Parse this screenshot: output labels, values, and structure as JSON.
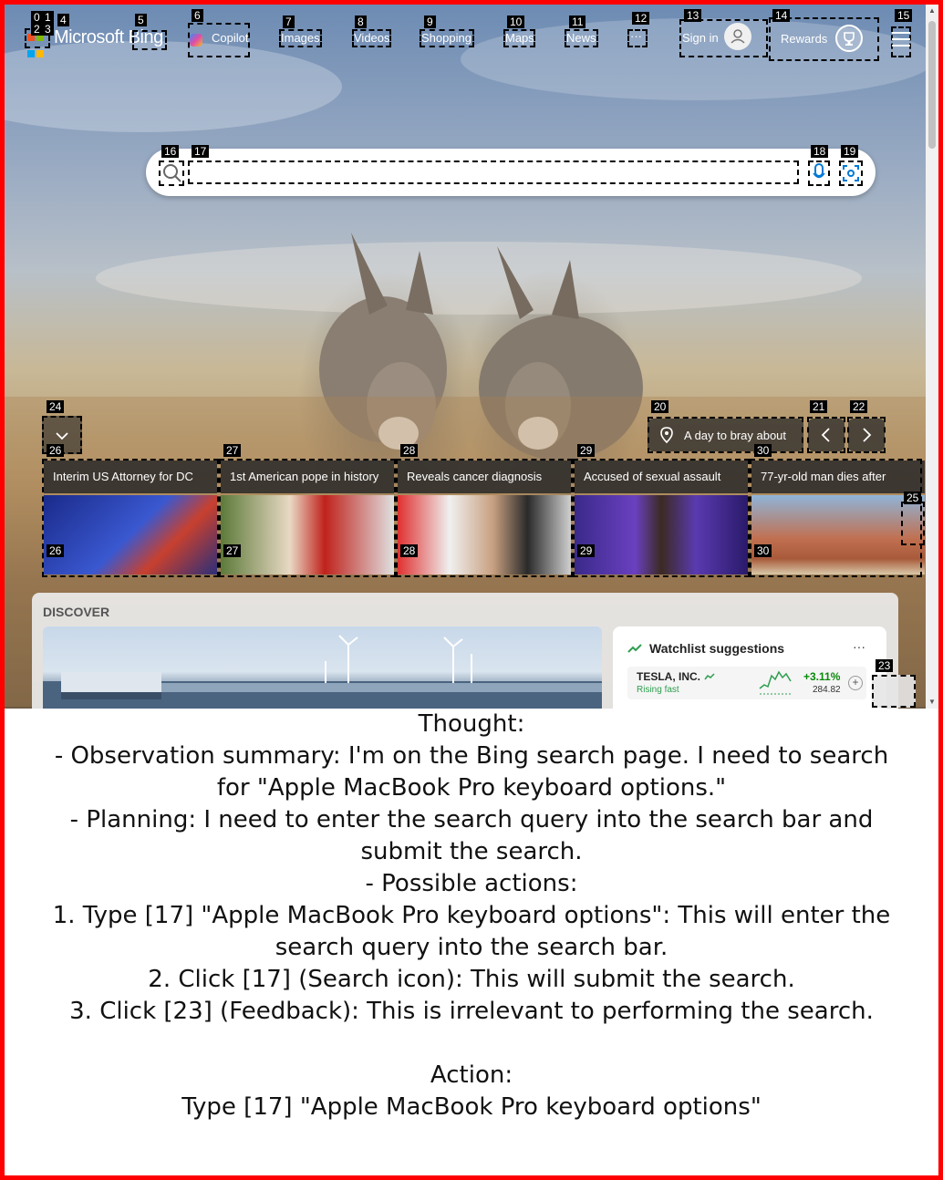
{
  "colors": {
    "frame": "#ff0000",
    "accent": "#0078d4",
    "positive": "#0a8a0a",
    "rising": "#2e9e4f"
  },
  "nav": {
    "brand": "Microsoft Bing",
    "links": [
      {
        "id": "copilot",
        "label": "Copilot"
      },
      {
        "id": "images",
        "label": "Images"
      },
      {
        "id": "videos",
        "label": "Videos"
      },
      {
        "id": "shopping",
        "label": "Shopping"
      },
      {
        "id": "maps",
        "label": "Maps"
      },
      {
        "id": "news",
        "label": "News"
      }
    ],
    "more": "···",
    "sign_in": "Sign in",
    "rewards": "Rewards"
  },
  "search": {
    "placeholder": ""
  },
  "hero": {
    "caption": "A day to bray about"
  },
  "news_cards": [
    {
      "title": "Interim US Attorney for DC"
    },
    {
      "title": "1st American pope in history"
    },
    {
      "title": "Reveals cancer diagnosis"
    },
    {
      "title": "Accused of sexual assault"
    },
    {
      "title": "77-yr-old man dies after"
    }
  ],
  "discover": {
    "label": "DISCOVER",
    "watchlist_title": "Watchlist suggestions",
    "watchlist_more": "···",
    "stock": {
      "name": "TESLA, INC.",
      "status": "Rising fast",
      "change": "+3.11%",
      "price": "284.82"
    }
  },
  "tags": [
    "0",
    "1",
    "2",
    "3",
    "4",
    "5",
    "6",
    "7",
    "8",
    "9",
    "10",
    "11",
    "12",
    "13",
    "14",
    "15",
    "16",
    "17",
    "18",
    "19",
    "20",
    "21",
    "22",
    "23",
    "24",
    "25",
    "26",
    "27",
    "28",
    "29",
    "30"
  ],
  "thought_lines": [
    "Thought:",
    "- Observation summary: I'm on the Bing search page. I need to search for \"Apple MacBook Pro keyboard options.\"",
    "- Planning: I need to enter the search query into the search bar and submit the search.",
    "- Possible actions:",
    "1. Type [17] \"Apple MacBook Pro keyboard options\": This will enter the search query into the search bar.",
    "2. Click [17] (Search icon): This will submit the search.",
    "3. Click [23] (Feedback): This is irrelevant to performing the search.",
    "",
    "Action:",
    "Type [17] \"Apple MacBook Pro keyboard options\""
  ]
}
